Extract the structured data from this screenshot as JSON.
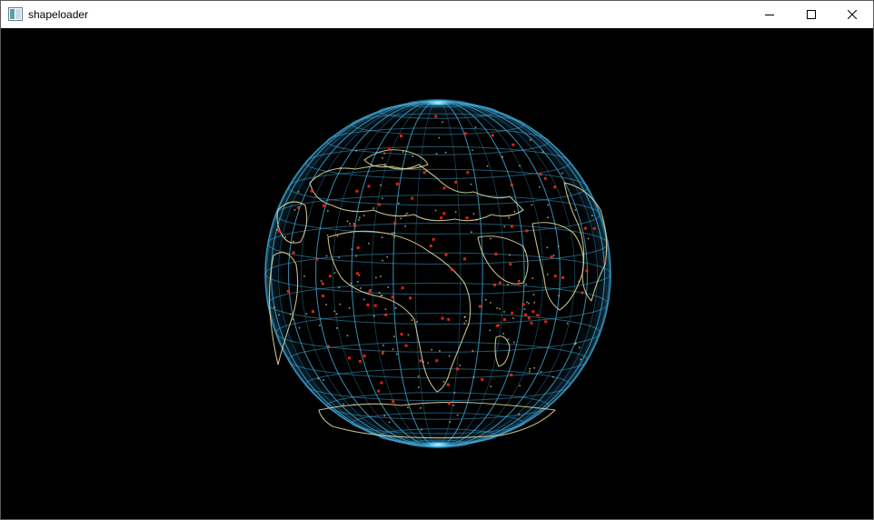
{
  "window": {
    "title": "shapeloader",
    "icon": "app-window-icon",
    "controls": [
      "minimize-icon",
      "maximize-icon",
      "close-icon"
    ]
  },
  "scene": {
    "kind": "wireframe-globe",
    "colors": {
      "background": "#000000",
      "grid": "#3fa9d6",
      "pole_glow": "#9fe9ff",
      "coastline": "#e8dca0",
      "markers": "#ff2a1a"
    }
  }
}
